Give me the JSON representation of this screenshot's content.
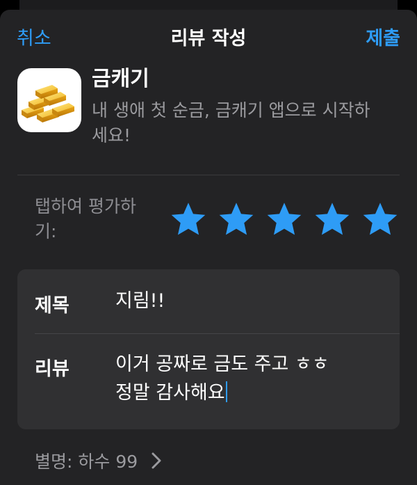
{
  "nav": {
    "cancel_label": "취소",
    "title": "리뷰 작성",
    "submit_label": "제출"
  },
  "app": {
    "name": "금캐기",
    "subtitle": "내 생애 첫 순금, 금캐기 앱으로 시작하세요!",
    "icon": "gold-bars-icon"
  },
  "rating": {
    "label": "탭하여 평가하기:",
    "value": 5,
    "max": 5,
    "star_color": "#2e9cf6"
  },
  "form": {
    "title_label": "제목",
    "title_value": "지림!!",
    "review_label": "리뷰",
    "review_line1": "이거 공짜로 금도 주고 ㅎㅎ",
    "review_line2": "정말 감사해요"
  },
  "nickname": {
    "text": "별명: 하수 99"
  },
  "colors": {
    "accent": "#2e9cf6",
    "sheet_background": "#232325",
    "field_background": "#303032"
  }
}
